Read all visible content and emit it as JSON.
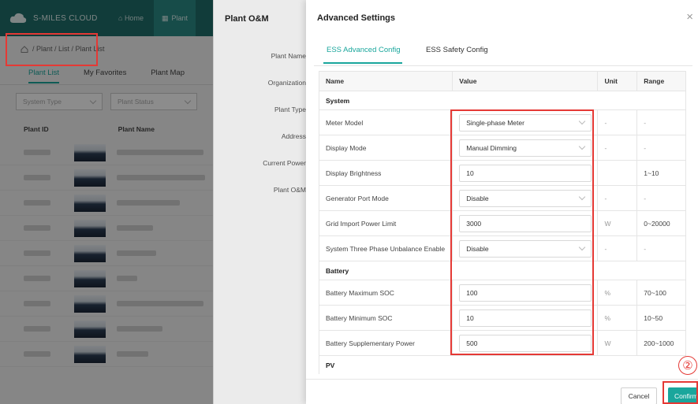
{
  "app": {
    "brand": "S-MILES CLOUD",
    "nav": {
      "home": "Home",
      "plant": "Plant"
    },
    "breadcrumb": "/ Plant / List / Plant List",
    "tabs": [
      "Plant List",
      "My Favorites",
      "Plant Map"
    ],
    "filters": [
      "System Type",
      "Plant Status"
    ],
    "columns": [
      "Plant ID",
      "Plant Name"
    ]
  },
  "om": {
    "title": "Plant O&M",
    "fields": [
      "Plant Name",
      "Organization",
      "Plant Type",
      "Address",
      "Current Power",
      "Plant O&M"
    ]
  },
  "modal": {
    "title": "Advanced Settings",
    "close": "×",
    "tabs": [
      {
        "label": "ESS Advanced Config",
        "active": true
      },
      {
        "label": "ESS Safety Config",
        "active": false
      }
    ],
    "headers": {
      "name": "Name",
      "value": "Value",
      "unit": "Unit",
      "range": "Range"
    },
    "sections": {
      "system": "System",
      "battery": "Battery",
      "pv": "PV"
    },
    "rows": [
      {
        "name": "Meter Model",
        "value": "Single-phase Meter",
        "type": "select",
        "unit": "-",
        "range": "-"
      },
      {
        "name": "Display Mode",
        "value": "Manual Dimming",
        "type": "select",
        "unit": "-",
        "range": "-"
      },
      {
        "name": "Display Brightness",
        "value": "10",
        "type": "input",
        "unit": "",
        "range": "1~10"
      },
      {
        "name": "Generator Port Mode",
        "value": "Disable",
        "type": "select",
        "unit": "-",
        "range": "-"
      },
      {
        "name": "Grid Import Power Limit",
        "value": "3000",
        "type": "input",
        "unit": "W",
        "range": "0~20000"
      },
      {
        "name": "System Three Phase Unbalance Enable",
        "value": "Disable",
        "type": "select",
        "unit": "-",
        "range": "-"
      },
      {
        "name": "Battery Maximum SOC",
        "value": "100",
        "type": "input",
        "unit": "%",
        "range": "70~100"
      },
      {
        "name": "Battery Minimum SOC",
        "value": "10",
        "type": "input",
        "unit": "%",
        "range": "10~50"
      },
      {
        "name": "Battery Supplementary Power",
        "value": "500",
        "type": "input",
        "unit": "W",
        "range": "200~1000"
      }
    ],
    "footer": {
      "cancel": "Cancel",
      "confirm": "Confirm"
    },
    "annotation": "②"
  },
  "colors": {
    "accent": "#1aa69c",
    "highlight": "#e53935",
    "nav": "#1f6d6a"
  }
}
